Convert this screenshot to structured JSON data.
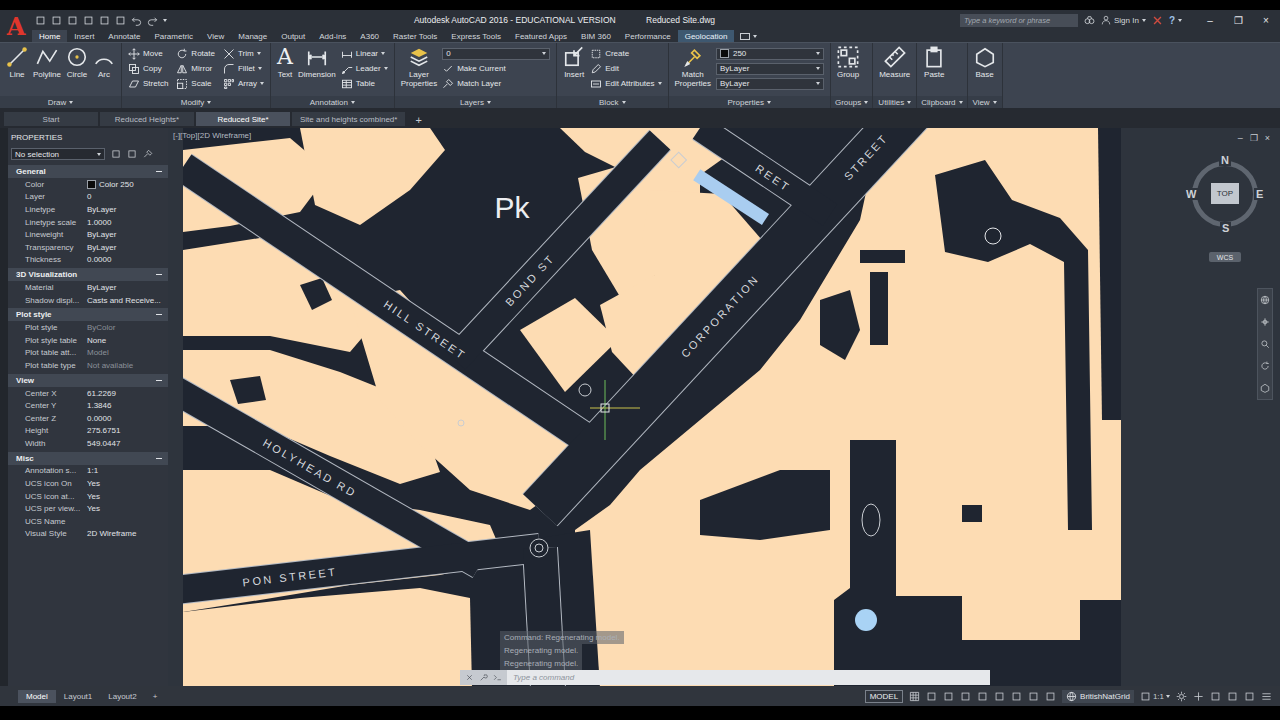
{
  "window": {
    "logo": "A",
    "title": "Autodesk AutoCAD 2016 - EDUCATIONAL VERSION",
    "file": "Reduced Site.dwg",
    "search_placeholder": "Type a keyword or phrase",
    "user": "Sign In",
    "help": "?",
    "controls": [
      "–",
      "❐",
      "×"
    ]
  },
  "ribbon_tabs": [
    {
      "label": "Home",
      "selected": true,
      "contextual": false
    },
    {
      "label": "Insert",
      "selected": false,
      "contextual": false
    },
    {
      "label": "Annotate",
      "selected": false,
      "contextual": false
    },
    {
      "label": "Parametric",
      "selected": false,
      "contextual": false
    },
    {
      "label": "View",
      "selected": false,
      "contextual": false
    },
    {
      "label": "Manage",
      "selected": false,
      "contextual": false
    },
    {
      "label": "Output",
      "selected": false,
      "contextual": false
    },
    {
      "label": "Add-ins",
      "selected": false,
      "contextual": false
    },
    {
      "label": "A360",
      "selected": false,
      "contextual": false
    },
    {
      "label": "Raster Tools",
      "selected": false,
      "contextual": false
    },
    {
      "label": "Express Tools",
      "selected": false,
      "contextual": false
    },
    {
      "label": "Featured Apps",
      "selected": false,
      "contextual": false
    },
    {
      "label": "BIM 360",
      "selected": false,
      "contextual": false
    },
    {
      "label": "Performance",
      "selected": false,
      "contextual": false
    },
    {
      "label": "Geolocation",
      "selected": false,
      "contextual": true
    }
  ],
  "ribbon_panels": [
    {
      "title": "Draw",
      "items": [
        {
          "label": "Line",
          "kind": "large",
          "flyout": false
        },
        {
          "label": "Polyline",
          "kind": "large",
          "flyout": false
        },
        {
          "label": "Circle",
          "kind": "large",
          "flyout": false
        },
        {
          "label": "Arc",
          "kind": "large",
          "flyout": false
        }
      ]
    },
    {
      "title": "Modify",
      "items": [
        {
          "label": "Move",
          "kind": "small",
          "flyout": false
        },
        {
          "label": "Copy",
          "kind": "small",
          "flyout": false
        },
        {
          "label": "Stretch",
          "kind": "small",
          "flyout": false
        },
        {
          "label": "Rotate",
          "kind": "small",
          "flyout": false
        },
        {
          "label": "Mirror",
          "kind": "small",
          "flyout": false
        },
        {
          "label": "Scale",
          "kind": "small",
          "flyout": false
        },
        {
          "label": "Trim",
          "kind": "small",
          "flyout": true
        },
        {
          "label": "Fillet",
          "kind": "small",
          "flyout": true
        },
        {
          "label": "Array",
          "kind": "small",
          "flyout": true
        }
      ]
    },
    {
      "title": "Annotation",
      "items": [
        {
          "label": "Text",
          "kind": "large",
          "flyout": false,
          "glyph": "A"
        },
        {
          "label": "Dimension",
          "kind": "large",
          "flyout": false
        },
        {
          "label": "Linear",
          "kind": "small",
          "flyout": true
        },
        {
          "label": "Leader",
          "kind": "small",
          "flyout": true
        },
        {
          "label": "Table",
          "kind": "small",
          "flyout": false
        }
      ]
    },
    {
      "title": "Layers",
      "items": [
        {
          "label": "Layer Properties",
          "kind": "large",
          "flyout": false
        },
        {
          "label": "0",
          "kind": "dropdown",
          "flyout": false
        },
        {
          "label": "Make Current",
          "kind": "small",
          "flyout": false
        },
        {
          "label": "Match Layer",
          "kind": "small",
          "flyout": false
        }
      ]
    },
    {
      "title": "Block",
      "items": [
        {
          "label": "Insert",
          "kind": "large",
          "flyout": false
        },
        {
          "label": "Create",
          "kind": "small",
          "flyout": false
        },
        {
          "label": "Edit",
          "kind": "small",
          "flyout": false
        },
        {
          "label": "Edit Attributes",
          "kind": "small",
          "flyout": true
        }
      ]
    },
    {
      "title": "Properties",
      "items": [
        {
          "label": "Match Properties",
          "kind": "large",
          "flyout": false
        },
        {
          "label": "250",
          "kind": "color-dropdown",
          "flyout": false
        },
        {
          "label": "ByLayer",
          "kind": "dropdown",
          "flyout": false
        },
        {
          "label": "ByLayer",
          "kind": "dropdown",
          "flyout": false
        }
      ]
    },
    {
      "title": "Groups",
      "items": [
        {
          "label": "Group",
          "kind": "large",
          "flyout": false
        }
      ]
    },
    {
      "title": "Utilities",
      "items": [
        {
          "label": "Measure",
          "kind": "large",
          "flyout": false
        }
      ]
    },
    {
      "title": "Clipboard",
      "items": [
        {
          "label": "Paste",
          "kind": "large",
          "flyout": false
        }
      ]
    },
    {
      "title": "View",
      "items": [
        {
          "label": "Base",
          "kind": "large",
          "flyout": false
        }
      ]
    }
  ],
  "file_tabs": [
    {
      "label": "Start",
      "selected": false
    },
    {
      "label": "Reduced Heights*",
      "selected": false
    },
    {
      "label": "Reduced Site*",
      "selected": true
    },
    {
      "label": "Site and heights combined*",
      "selected": false
    }
  ],
  "new_file_tab": "+",
  "properties_palette": {
    "title": "PROPERTIES",
    "selection": "No selection",
    "sections": [
      {
        "title": "General",
        "expanded": true,
        "rows": [
          {
            "label": "Color",
            "value": "Color 250",
            "kind": "swatch",
            "disabled": false
          },
          {
            "label": "Layer",
            "value": "0",
            "kind": "text",
            "disabled": false
          },
          {
            "label": "Linetype",
            "value": "ByLayer",
            "kind": "text",
            "disabled": false
          },
          {
            "label": "Linetype scale",
            "value": "1.0000",
            "kind": "text",
            "disabled": false
          },
          {
            "label": "Lineweight",
            "value": "ByLayer",
            "kind": "text",
            "disabled": false
          },
          {
            "label": "Transparency",
            "value": "ByLayer",
            "kind": "text",
            "disabled": false
          },
          {
            "label": "Thickness",
            "value": "0.0000",
            "kind": "text",
            "disabled": false
          }
        ]
      },
      {
        "title": "3D Visualization",
        "expanded": true,
        "rows": [
          {
            "label": "Material",
            "value": "ByLayer",
            "kind": "text",
            "disabled": false
          },
          {
            "label": "Shadow displ...",
            "value": "Casts and Receive...",
            "kind": "text",
            "disabled": false
          }
        ]
      },
      {
        "title": "Plot style",
        "expanded": true,
        "rows": [
          {
            "label": "Plot style",
            "value": "ByColor",
            "kind": "text",
            "disabled": true
          },
          {
            "label": "Plot style table",
            "value": "None",
            "kind": "text",
            "disabled": false
          },
          {
            "label": "Plot table att...",
            "value": "Model",
            "kind": "text",
            "disabled": true
          },
          {
            "label": "Plot table type",
            "value": "Not available",
            "kind": "text",
            "disabled": true
          }
        ]
      },
      {
        "title": "View",
        "expanded": true,
        "rows": [
          {
            "label": "Center X",
            "value": "61.2269",
            "kind": "text",
            "disabled": false
          },
          {
            "label": "Center Y",
            "value": "1.3846",
            "kind": "text",
            "disabled": false
          },
          {
            "label": "Center Z",
            "value": "0.0000",
            "kind": "text",
            "disabled": false
          },
          {
            "label": "Height",
            "value": "275.6751",
            "kind": "text",
            "disabled": false
          },
          {
            "label": "Width",
            "value": "549.0447",
            "kind": "text",
            "disabled": false
          }
        ]
      },
      {
        "title": "Misc",
        "expanded": true,
        "rows": [
          {
            "label": "Annotation s...",
            "value": "1:1",
            "kind": "text",
            "disabled": false
          },
          {
            "label": "UCS icon On",
            "value": "Yes",
            "kind": "text",
            "disabled": false
          },
          {
            "label": "UCS icon at...",
            "value": "Yes",
            "kind": "text",
            "disabled": false
          },
          {
            "label": "UCS per view...",
            "value": "Yes",
            "kind": "text",
            "disabled": false
          },
          {
            "label": "UCS Name",
            "value": "",
            "kind": "text",
            "disabled": false
          },
          {
            "label": "Visual Style",
            "value": "2D Wireframe",
            "kind": "text",
            "disabled": false
          }
        ]
      }
    ]
  },
  "viewport": {
    "label": "[-][Top][2D Wireframe]",
    "controls": [
      "–",
      "❐",
      "×"
    ],
    "labels": [
      {
        "text": "Pk",
        "kind": "area"
      },
      {
        "text": "HILL STREET",
        "kind": "street"
      },
      {
        "text": "BOND ST",
        "kind": "street"
      },
      {
        "text": "CORPORATION",
        "kind": "street"
      },
      {
        "text": "STREET",
        "kind": "street"
      },
      {
        "text": "REET",
        "kind": "street"
      },
      {
        "text": "HOLYHEAD RD",
        "kind": "street"
      },
      {
        "text": "PON STREET",
        "kind": "street"
      }
    ]
  },
  "viewcube": {
    "north": "N",
    "east": "E",
    "south": "S",
    "west": "W",
    "face": "TOP",
    "ucs": "WCS"
  },
  "command_line": {
    "history": [
      "Command: Regenerating model.",
      "Regenerating model.",
      "Regenerating model."
    ],
    "placeholder": "Type a command"
  },
  "status_bar": {
    "layouts": [
      {
        "label": "Model",
        "selected": true
      },
      {
        "label": "Layout1",
        "selected": false
      },
      {
        "label": "Layout2",
        "selected": false
      }
    ],
    "new_layout": "+",
    "space": "MODEL",
    "coordinate_system": "BritishNatGrid",
    "scale": "1:1"
  }
}
